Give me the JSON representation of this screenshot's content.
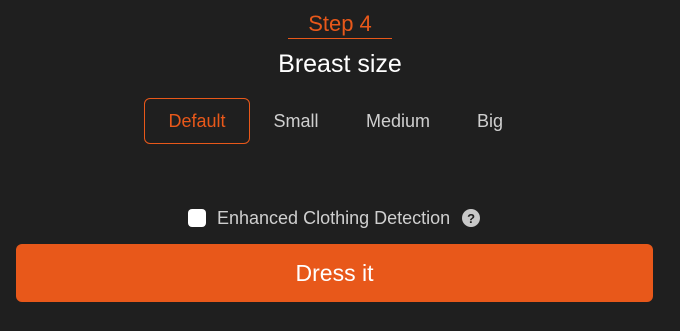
{
  "step": {
    "label": "Step 4"
  },
  "section": {
    "title": "Breast size"
  },
  "size_options": [
    {
      "label": "Default",
      "selected": true
    },
    {
      "label": "Small",
      "selected": false
    },
    {
      "label": "Medium",
      "selected": false
    },
    {
      "label": "Big",
      "selected": false
    }
  ],
  "detection": {
    "label": "Enhanced Clothing Detection",
    "checked": false,
    "help_icon": "question-icon",
    "help_glyph": "?"
  },
  "action": {
    "label": "Dress it"
  },
  "colors": {
    "accent": "#e8581a",
    "background": "#1f1f1f"
  }
}
